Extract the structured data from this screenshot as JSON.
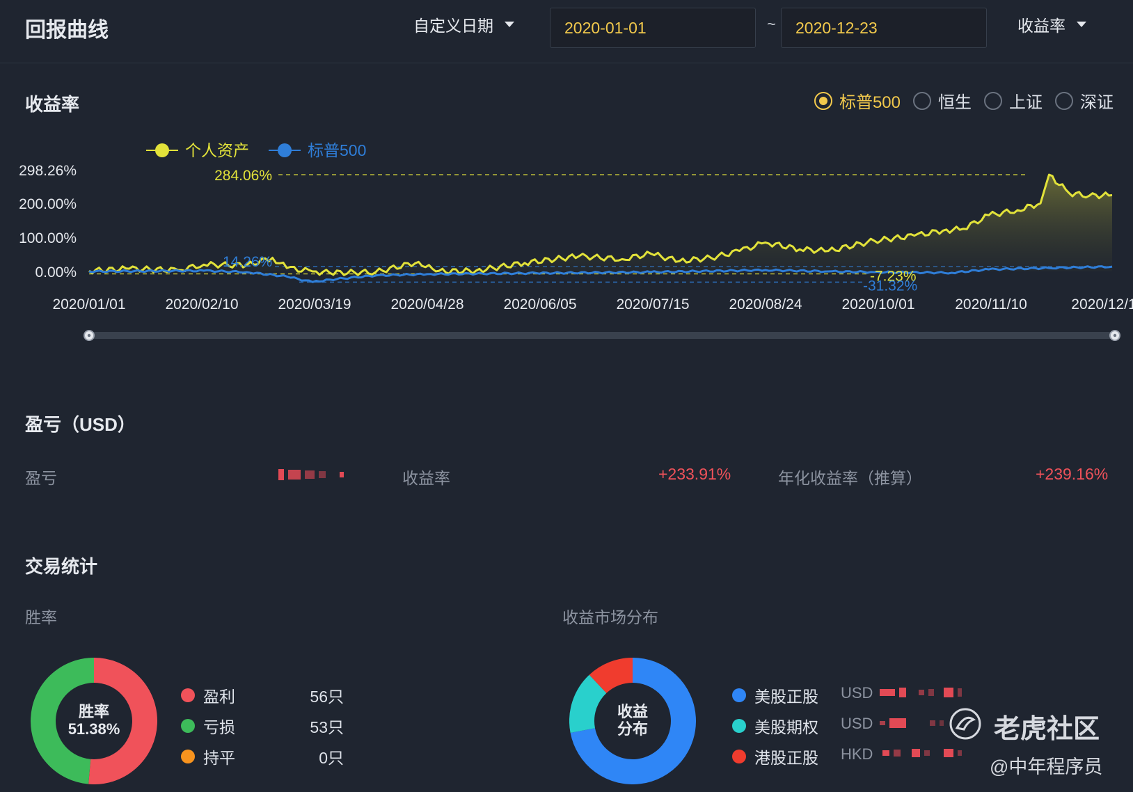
{
  "header": {
    "title": "回报曲线",
    "date_mode": "自定义日期",
    "start_date": "2020-01-01",
    "range_sep": "~",
    "end_date": "2020-12-23",
    "metric": "收益率"
  },
  "returns": {
    "title": "收益率",
    "benchmarks": [
      {
        "label": "标普500",
        "selected": true
      },
      {
        "label": "恒生",
        "selected": false
      },
      {
        "label": "上证",
        "selected": false
      },
      {
        "label": "深证",
        "selected": false
      }
    ]
  },
  "chart_data": {
    "type": "line",
    "legend_position": "top-left",
    "grid": false,
    "y_ticks": [
      "298.26%",
      "200.00%",
      "100.00%",
      "0.00%"
    ],
    "x_ticks": [
      "2020/01/01",
      "2020/02/10",
      "2020/03/19",
      "2020/04/28",
      "2020/06/05",
      "2020/07/15",
      "2020/08/24",
      "2020/10/01",
      "2020/11/10",
      "2020/12/1"
    ],
    "ylim": [
      -40,
      298.26
    ],
    "series": [
      {
        "name": "个人资产",
        "color": "#e2e23a",
        "x": [
          "2020/01/01",
          "2020/01/15",
          "2020/02/01",
          "2020/02/10",
          "2020/02/25",
          "2020/03/05",
          "2020/03/10",
          "2020/03/19",
          "2020/03/25",
          "2020/04/10",
          "2020/04/25",
          "2020/05/01",
          "2020/05/15",
          "2020/06/01",
          "2020/06/20",
          "2020/07/05",
          "2020/07/15",
          "2020/07/25",
          "2020/08/05",
          "2020/08/15",
          "2020/08/24",
          "2020/09/05",
          "2020/09/15",
          "2020/10/01",
          "2020/10/15",
          "2020/10/25",
          "2020/11/01",
          "2020/11/10",
          "2020/11/20",
          "2020/11/28",
          "2020/12/01",
          "2020/12/08",
          "2020/12/15",
          "2020/12/23"
        ],
        "values": [
          2,
          8,
          4,
          20,
          18,
          40,
          10,
          0,
          -4,
          -2,
          28,
          0,
          2,
          25,
          45,
          36,
          52,
          30,
          40,
          60,
          85,
          65,
          60,
          90,
          105,
          120,
          125,
          165,
          180,
          200,
          284,
          230,
          222,
          224
        ]
      },
      {
        "name": "标普500",
        "color": "#2f7ed8",
        "x": [
          "2020/01/01",
          "2020/02/10",
          "2020/02/25",
          "2020/03/10",
          "2020/03/19",
          "2020/03/25",
          "2020/04/10",
          "2020/04/28",
          "2020/06/05",
          "2020/07/15",
          "2020/08/24",
          "2020/09/15",
          "2020/10/01",
          "2020/10/28",
          "2020/11/10",
          "2020/12/01",
          "2020/12/23"
        ],
        "values": [
          0,
          2,
          -2,
          -15,
          -31.32,
          -24,
          -12,
          -8,
          -5,
          -2,
          4,
          0,
          -2,
          -4,
          6,
          10,
          14
        ]
      }
    ],
    "annotations": [
      {
        "label": "284.06%",
        "series": "个人资产",
        "type": "max",
        "value": 284.06
      },
      {
        "label": "-7.23%",
        "series": "个人资产",
        "type": "min",
        "value": -7.23
      },
      {
        "label": "14.26%",
        "series": "标普500",
        "type": "max",
        "value": 14.26
      },
      {
        "label": "-31.32%",
        "series": "标普500",
        "type": "min",
        "value": -31.32
      }
    ]
  },
  "pnl": {
    "title": "盈亏（USD）",
    "pnl_label": "盈亏",
    "return_label": "收益率",
    "return_value": "+233.91%",
    "annual_label": "年化收益率（推算）",
    "annual_value": "+239.16%"
  },
  "trade_stats": {
    "title": "交易统计",
    "win_rate_title": "胜率",
    "win_center_line1": "胜率",
    "win_center_value": "51.38%",
    "win_items": [
      {
        "label": "盈利",
        "count": "56只",
        "color": "#f0525a",
        "share": 0.5138
      },
      {
        "label": "亏损",
        "count": "53只",
        "color": "#3dbb5a",
        "share": 0.4862
      },
      {
        "label": "持平",
        "count": "0只",
        "color": "#f7931e",
        "share": 0
      }
    ],
    "market_title": "收益市场分布",
    "market_center_line1": "收益",
    "market_center_line2": "分布",
    "market_items": [
      {
        "label": "美股正股",
        "currency": "USD",
        "color": "#2f86f6",
        "share": 0.72
      },
      {
        "label": "美股期权",
        "currency": "USD",
        "color": "#29d0cc",
        "share": 0.16
      },
      {
        "label": "港股正股",
        "currency": "HKD",
        "color": "#f03c2e",
        "share": 0.12
      }
    ]
  },
  "watermark": {
    "brand": "老虎社区",
    "author": "@中年程序员"
  }
}
